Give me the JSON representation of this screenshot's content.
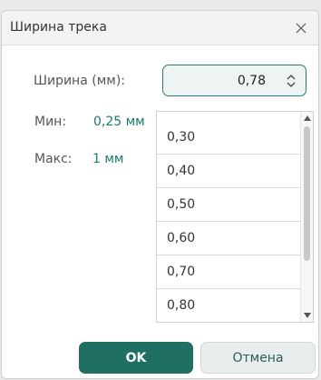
{
  "dialog": {
    "title": "Ширина трека",
    "close_glyph": "×"
  },
  "form": {
    "width_label": "Ширина (мм):",
    "width_value": "0,78",
    "min_label": "Мин:",
    "min_value": "0,25 мм",
    "max_label": "Макс:",
    "max_value": "1 мм"
  },
  "list": {
    "items": [
      "0,30",
      "0,40",
      "0,50",
      "0,60",
      "0,70",
      "0,80"
    ]
  },
  "buttons": {
    "ok_label": "OK",
    "cancel_label": "Отмена"
  },
  "colors": {
    "accent": "#1f6f62",
    "value_text": "#177b6a"
  },
  "icons": {
    "close": "close-icon",
    "spinner": "chevron-up-down-icon",
    "scroll_up": "triangle-up-icon",
    "scroll_down": "triangle-down-icon"
  }
}
